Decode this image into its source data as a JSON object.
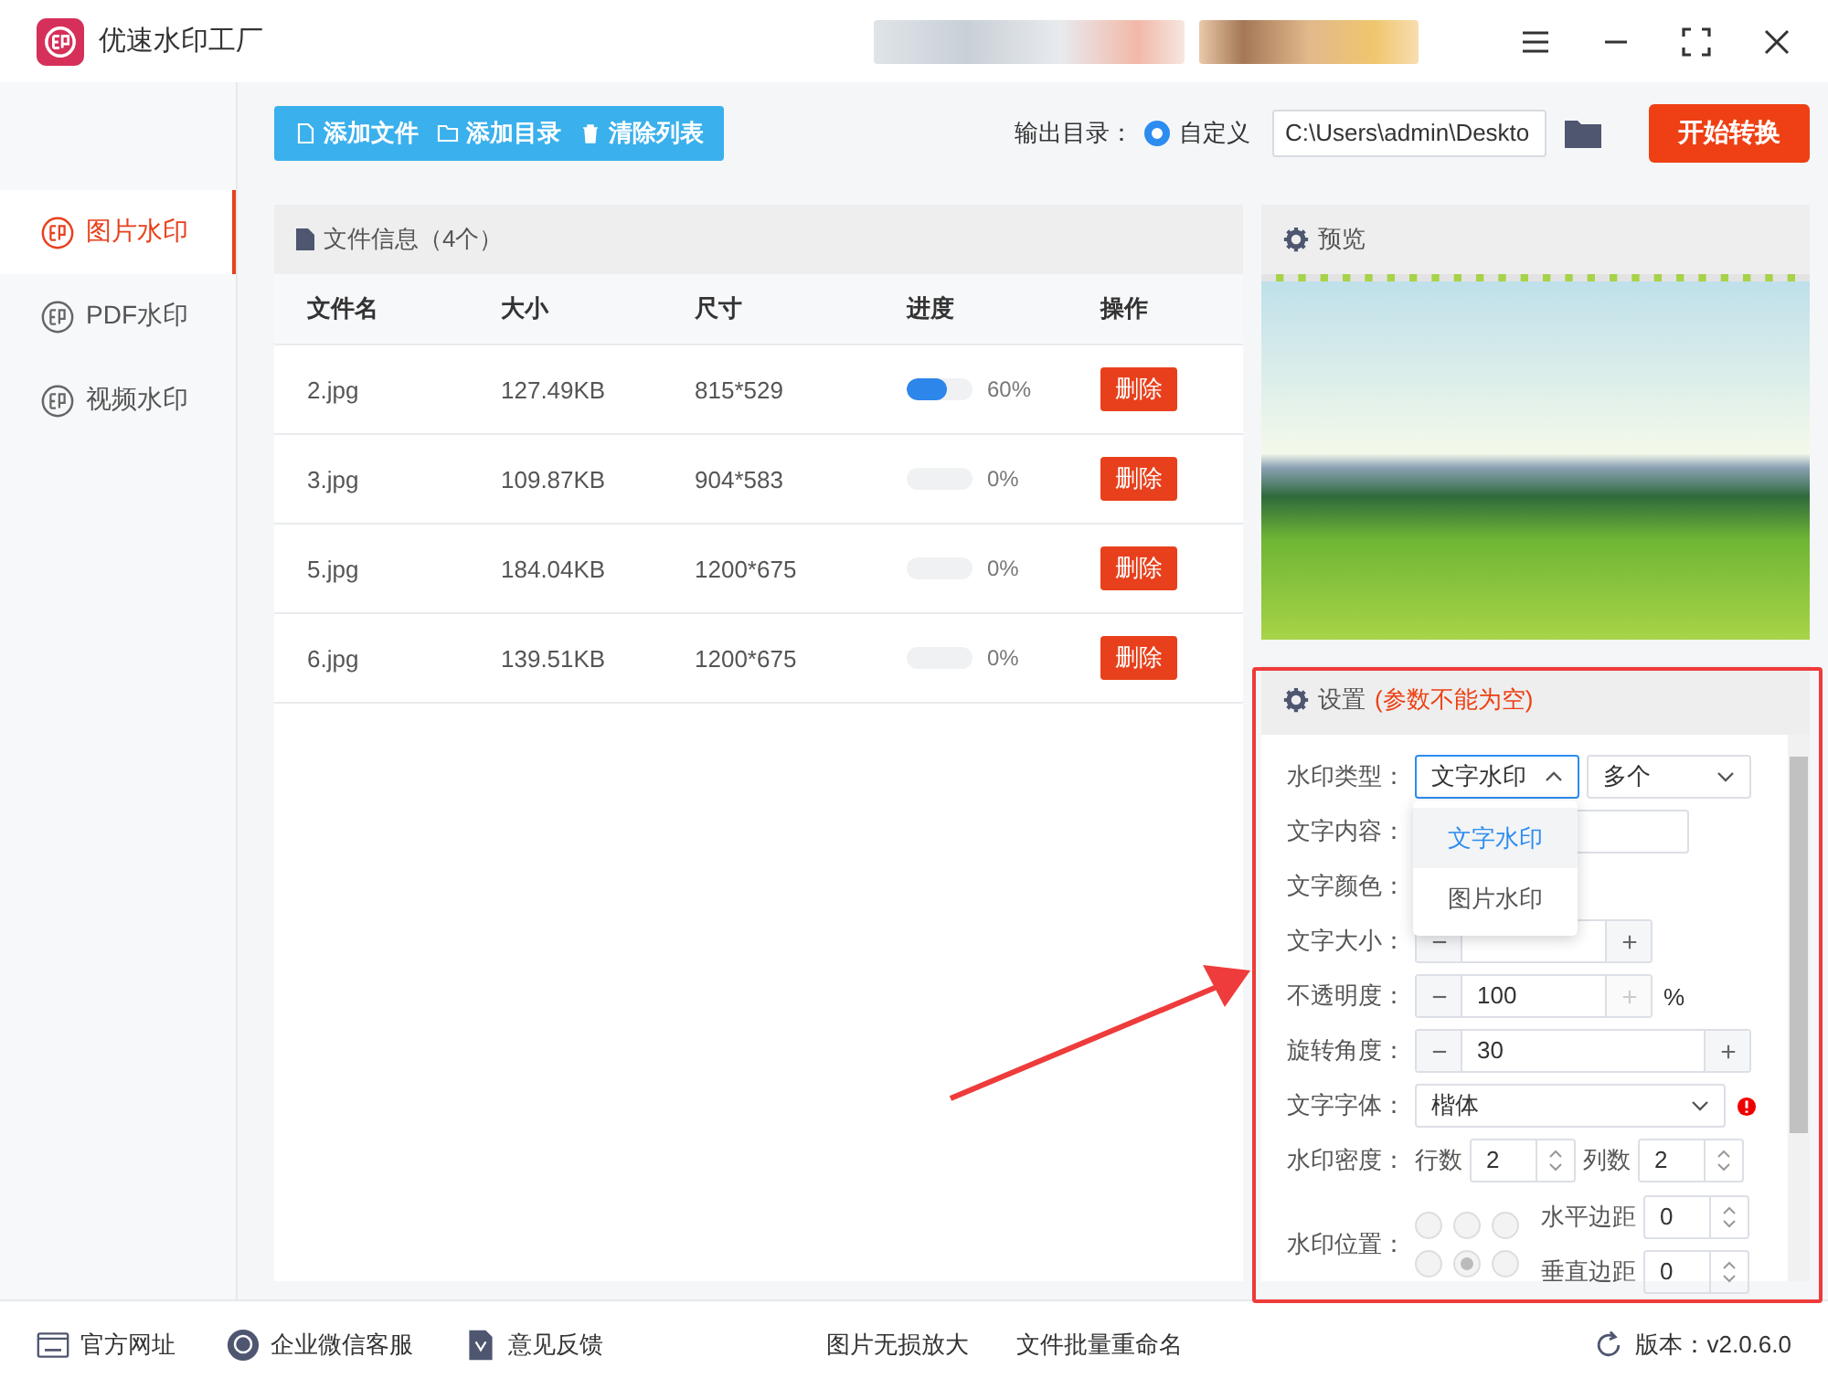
{
  "app": {
    "title": "优速水印工厂"
  },
  "toolbar": {
    "buttons": [
      {
        "label": "添加文件",
        "kind": "file"
      },
      {
        "label": "添加目录",
        "kind": "folder"
      },
      {
        "label": "清除列表",
        "kind": "trash"
      }
    ],
    "output_label": "输出目录：",
    "output_option": {
      "label": "自定义",
      "selected": true
    },
    "output_path": "C:\\Users\\admin\\Deskto",
    "start_button": "开始转换"
  },
  "sidebar": {
    "items": [
      {
        "label": "图片水印",
        "selected": true
      },
      {
        "label": "PDF水印",
        "selected": false
      },
      {
        "label": "视频水印",
        "selected": false
      }
    ]
  },
  "files": {
    "title": "文件信息（4个）",
    "columns": [
      "文件名",
      "大小",
      "尺寸",
      "进度",
      "操作"
    ],
    "rows": [
      {
        "name": "2.jpg",
        "size": "127.49KB",
        "dimensions": "815*529",
        "level": 0.6,
        "progress": "60%",
        "action": "删除"
      },
      {
        "name": "3.jpg",
        "size": "109.87KB",
        "dimensions": "904*583",
        "level": 0,
        "progress": "0%",
        "action": "删除"
      },
      {
        "name": "5.jpg",
        "size": "184.04KB",
        "dimensions": "1200*675",
        "level": 0,
        "progress": "0%",
        "action": "删除"
      },
      {
        "name": "6.jpg",
        "size": "139.51KB",
        "dimensions": "1200*675",
        "level": 0,
        "progress": "0%",
        "action": "删除"
      }
    ]
  },
  "preview": {
    "title": "预览"
  },
  "settings": {
    "title": "设置",
    "note": "(参数不能为空)",
    "fields": [
      {
        "kind": "select_pair",
        "label": "水印类型：",
        "value": "文字水印",
        "open": true,
        "second_value": "多个"
      },
      {
        "kind": "text",
        "label": "文字内容："
      },
      {
        "kind": "color",
        "label": "文字颜色："
      },
      {
        "kind": "stepper",
        "label": "文字大小：",
        "plus_disabled": false
      },
      {
        "kind": "stepper",
        "label": "不透明度：",
        "value": "100",
        "unit": "%",
        "plus_disabled": true
      },
      {
        "kind": "stepper",
        "label": "旋转角度：",
        "value": "30",
        "plus_disabled": false
      },
      {
        "kind": "select",
        "label": "文字字体：",
        "value": "楷体",
        "warning": true
      },
      {
        "kind": "density",
        "label": "水印密度：",
        "rows_label": "行数",
        "rows": "2",
        "cols_label": "列数",
        "cols": "2"
      },
      {
        "kind": "position",
        "label": "水印位置：",
        "cells": [
          {
            "selected": false
          },
          {
            "selected": false
          },
          {
            "selected": false
          },
          {
            "selected": false
          },
          {
            "selected": true
          },
          {
            "selected": false
          }
        ],
        "h_label": "水平边距",
        "h_value": "0",
        "v_label": "垂直边距",
        "v_value": "0"
      }
    ],
    "dropdown": {
      "options": [
        {
          "label": "文字水印",
          "selected": true
        },
        {
          "label": "图片水印",
          "selected": false
        }
      ]
    }
  },
  "footer": {
    "links": [
      {
        "label": "官方网址",
        "kind": "web"
      },
      {
        "label": "企业微信客服",
        "kind": "chat"
      },
      {
        "label": "意见反馈",
        "kind": "doc"
      }
    ],
    "tools": [
      "图片无损放大",
      "文件批量重命名"
    ],
    "version": "版本：v2.0.6.0"
  }
}
